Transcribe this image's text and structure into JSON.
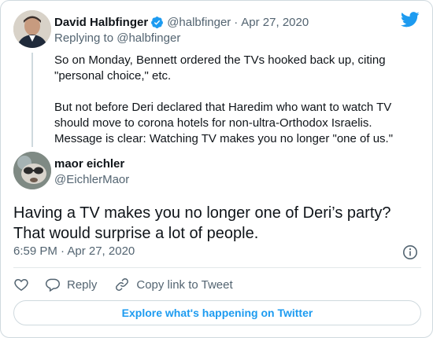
{
  "colors": {
    "accent": "#1d9bf0",
    "muted": "#536471",
    "text": "#0f1419",
    "border": "#cfd9de"
  },
  "parent_tweet": {
    "author_name": "David Halbfinger",
    "verified_icon": "verified-badge-icon",
    "handle": "@halbfinger",
    "separator": "·",
    "date": "Apr 27, 2020",
    "replying_to": "Replying to @halbfinger",
    "text": "So on Monday, Bennett ordered the TVs hooked back up, citing \"personal choice,\" etc.\n\nBut not before Deri declared that Haredim who want to watch TV should move to corona hotels for non-ultra-Orthodox Israelis. Message is clear: Watching TV makes you no longer \"one of us.\""
  },
  "brand_icon": "twitter-bird-icon",
  "main_tweet": {
    "author_name": "maor eichler",
    "handle": "@EichlerMaor",
    "text": "Having a TV makes you no longer one of Deri’s party? That would surprise a lot of people.",
    "timestamp": "6:59 PM · Apr 27, 2020",
    "info_icon": "info-icon"
  },
  "actions": {
    "like_icon": "heart-icon",
    "reply_label": "Reply",
    "reply_icon": "reply-bubble-icon",
    "copy_label": "Copy link to Tweet",
    "copy_icon": "link-icon"
  },
  "explore_label": "Explore what's happening on Twitter"
}
